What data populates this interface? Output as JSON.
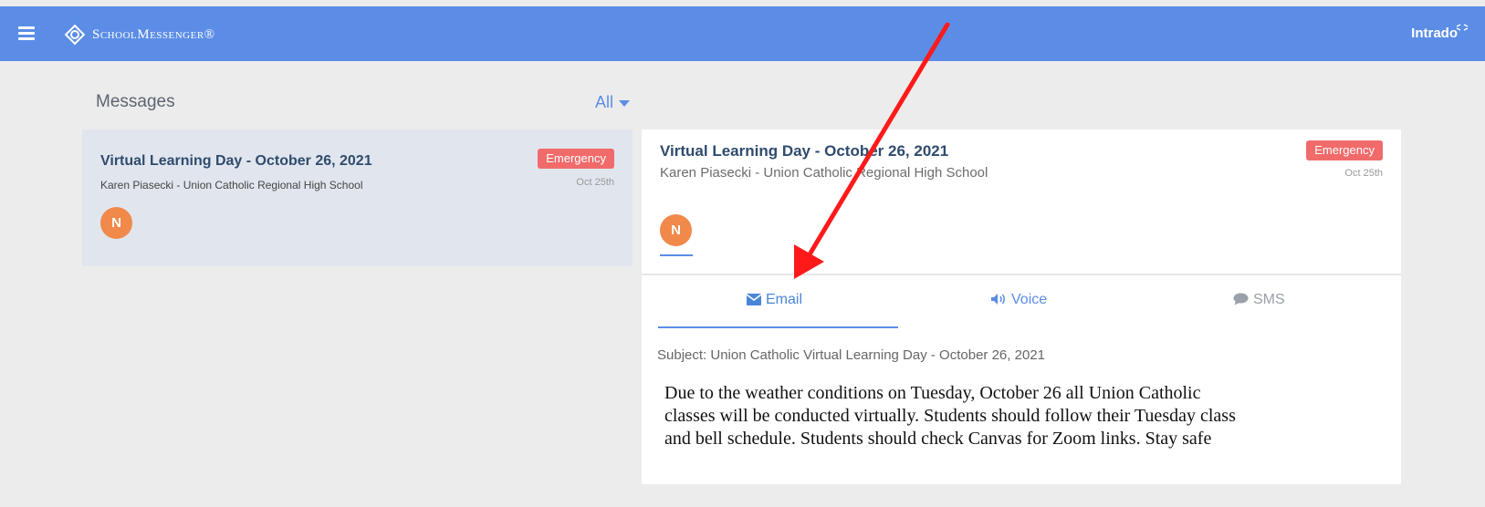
{
  "app": {
    "brand": "SchoolMessenger®",
    "partner": "Intrado",
    "accent_color": "#5b8de6",
    "menu_icon": "hamburger-icon",
    "logo_icon": "schoolmessenger-logo-icon"
  },
  "list": {
    "title": "Messages",
    "filter_label": "All",
    "items": [
      {
        "title": "Virtual Learning Day - October 26, 2021",
        "sender": "Karen Piasecki - Union Catholic Regional High School",
        "badge": "Emergency",
        "date": "Oct 25th",
        "avatar": "N"
      }
    ]
  },
  "detail": {
    "title": "Virtual Learning Day - October 26, 2021",
    "sender": "Karen Piasecki - Union Catholic Regional High School",
    "badge": "Emergency",
    "date": "Oct 25th",
    "avatar": "N",
    "tabs": [
      {
        "label": "Email",
        "icon": "envelope-icon",
        "active": true
      },
      {
        "label": "Voice",
        "icon": "speaker-icon",
        "active": false
      },
      {
        "label": "SMS",
        "icon": "chat-bubble-icon",
        "active": false
      }
    ],
    "subject": "Subject: Union Catholic Virtual Learning Day - October 26, 2021",
    "body_lines": [
      "Due to the weather conditions on Tuesday, October 26 all Union Catholic",
      "classes will be conducted virtually.  Students should follow their Tuesday class",
      "and bell schedule. Students should check Canvas for Zoom links. Stay safe"
    ]
  },
  "colors": {
    "badge": "#f26b6b",
    "avatar": "#f0894a",
    "annotation_arrow": "#ff1a1a"
  }
}
